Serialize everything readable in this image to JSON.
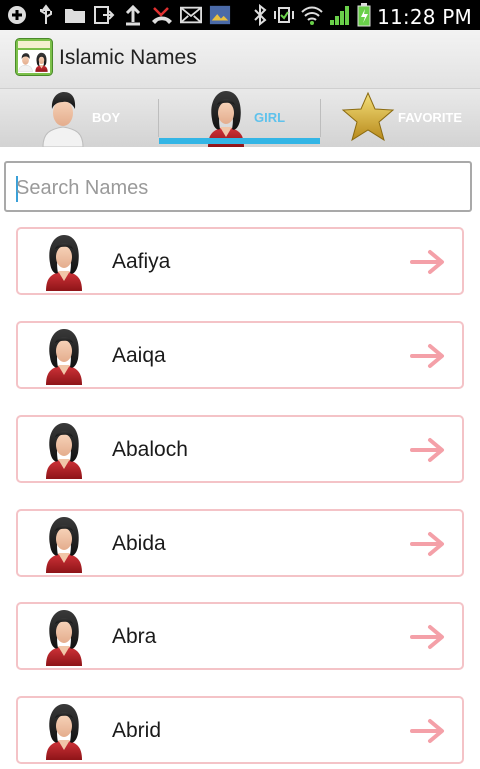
{
  "status_bar": {
    "time": "11:28 PM",
    "left_icons": [
      "add-icon",
      "usb-icon",
      "folder-icon",
      "file-export-icon",
      "upload-icon",
      "missed-call-icon",
      "email-icon",
      "image-icon"
    ],
    "right_icons": [
      "bluetooth-icon",
      "vibrate-icon",
      "wifi-icon",
      "signal-icon",
      "battery-icon"
    ]
  },
  "app": {
    "title": "Islamic Names"
  },
  "tabs": [
    {
      "label": "BOY",
      "icon": "boy-avatar-icon",
      "selected": false
    },
    {
      "label": "GIRL",
      "icon": "girl-avatar-icon",
      "selected": true
    },
    {
      "label": "FAVORITE",
      "icon": "star-icon",
      "selected": false
    }
  ],
  "search": {
    "placeholder": "Search Names",
    "value": ""
  },
  "names": [
    {
      "name": "Aafiya"
    },
    {
      "name": "Aaiqa"
    },
    {
      "name": "Abaloch"
    },
    {
      "name": "Abida"
    },
    {
      "name": "Abra"
    },
    {
      "name": "Abrid"
    }
  ],
  "colors": {
    "accent": "#33b5e5",
    "item_border": "#f4c3c7",
    "arrow": "#f4a0a8"
  }
}
